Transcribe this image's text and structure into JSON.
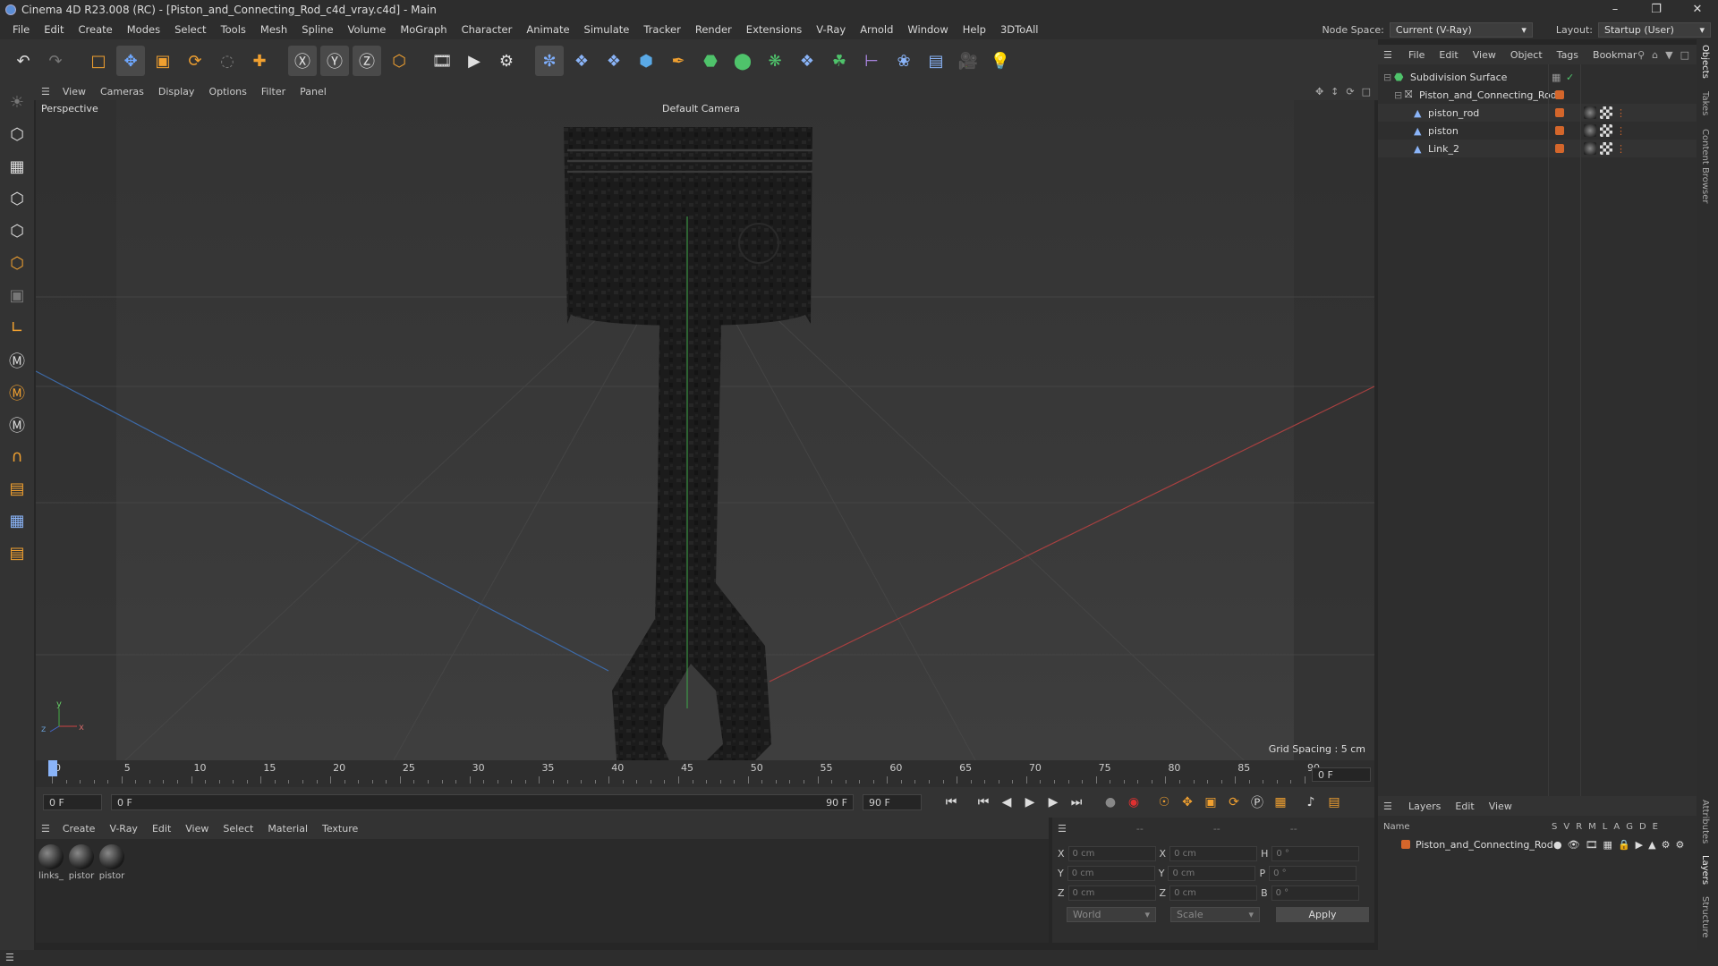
{
  "window": {
    "title": "Cinema 4D R23.008 (RC) - [Piston_and_Connecting_Rod_c4d_vray.c4d] - Main"
  },
  "menu": [
    "File",
    "Edit",
    "Create",
    "Modes",
    "Select",
    "Tools",
    "Mesh",
    "Spline",
    "Volume",
    "MoGraph",
    "Character",
    "Animate",
    "Simulate",
    "Tracker",
    "Render",
    "Extensions",
    "V-Ray",
    "Arnold",
    "Window",
    "Help",
    "3DToAll"
  ],
  "node_space": {
    "label": "Node Space:",
    "value": "Current (V-Ray)"
  },
  "layout": {
    "label": "Layout:",
    "value": "Startup (User)"
  },
  "viewport": {
    "menu": [
      "View",
      "Cameras",
      "Display",
      "Options",
      "Filter",
      "Panel"
    ],
    "label": "Perspective",
    "camera": "Default Camera",
    "grid_spacing": "Grid Spacing : 5 cm"
  },
  "timeline": {
    "ticks": [
      "0",
      "5",
      "10",
      "15",
      "20",
      "25",
      "30",
      "35",
      "40",
      "45",
      "50",
      "55",
      "60",
      "65",
      "70",
      "75",
      "80",
      "85",
      "90"
    ],
    "current_frame": "0 F",
    "start": "0 F",
    "range_start": "0 F",
    "range_end": "90 F",
    "end": "90 F"
  },
  "materials": {
    "menu": [
      "Create",
      "V-Ray",
      "Edit",
      "View",
      "Select",
      "Material",
      "Texture"
    ],
    "items": [
      "links_",
      "pistor",
      "pistor"
    ]
  },
  "coords": {
    "header": [
      "--",
      "--",
      "--"
    ],
    "rows": [
      {
        "a": "X",
        "av": "0 cm",
        "b": "X",
        "bv": "0 cm",
        "c": "H",
        "cv": "0 °"
      },
      {
        "a": "Y",
        "av": "0 cm",
        "b": "Y",
        "bv": "0 cm",
        "c": "P",
        "cv": "0 °"
      },
      {
        "a": "Z",
        "av": "0 cm",
        "b": "Z",
        "bv": "0 cm",
        "c": "B",
        "cv": "0 °"
      }
    ],
    "world": "World",
    "scale": "Scale",
    "apply": "Apply"
  },
  "objects": {
    "menu": [
      "File",
      "Edit",
      "View",
      "Object",
      "Tags",
      "Bookmar"
    ],
    "items": [
      "Subdivision Surface",
      "Piston_and_Connecting_Rod",
      "piston_rod",
      "piston",
      "Link_2"
    ]
  },
  "layers": {
    "menu": [
      "Layers",
      "Edit",
      "View"
    ],
    "name_col": "Name",
    "cols": [
      "S",
      "V",
      "R",
      "M",
      "L",
      "A",
      "G",
      "D",
      "E"
    ],
    "item": "Piston_and_Connecting_Rod"
  },
  "side_tabs": [
    "Objects",
    "Takes",
    "Content Browser",
    "Attributes",
    "Layers",
    "Structure"
  ],
  "colors": {
    "accent": "#d4662b",
    "green": "#4caf50"
  }
}
